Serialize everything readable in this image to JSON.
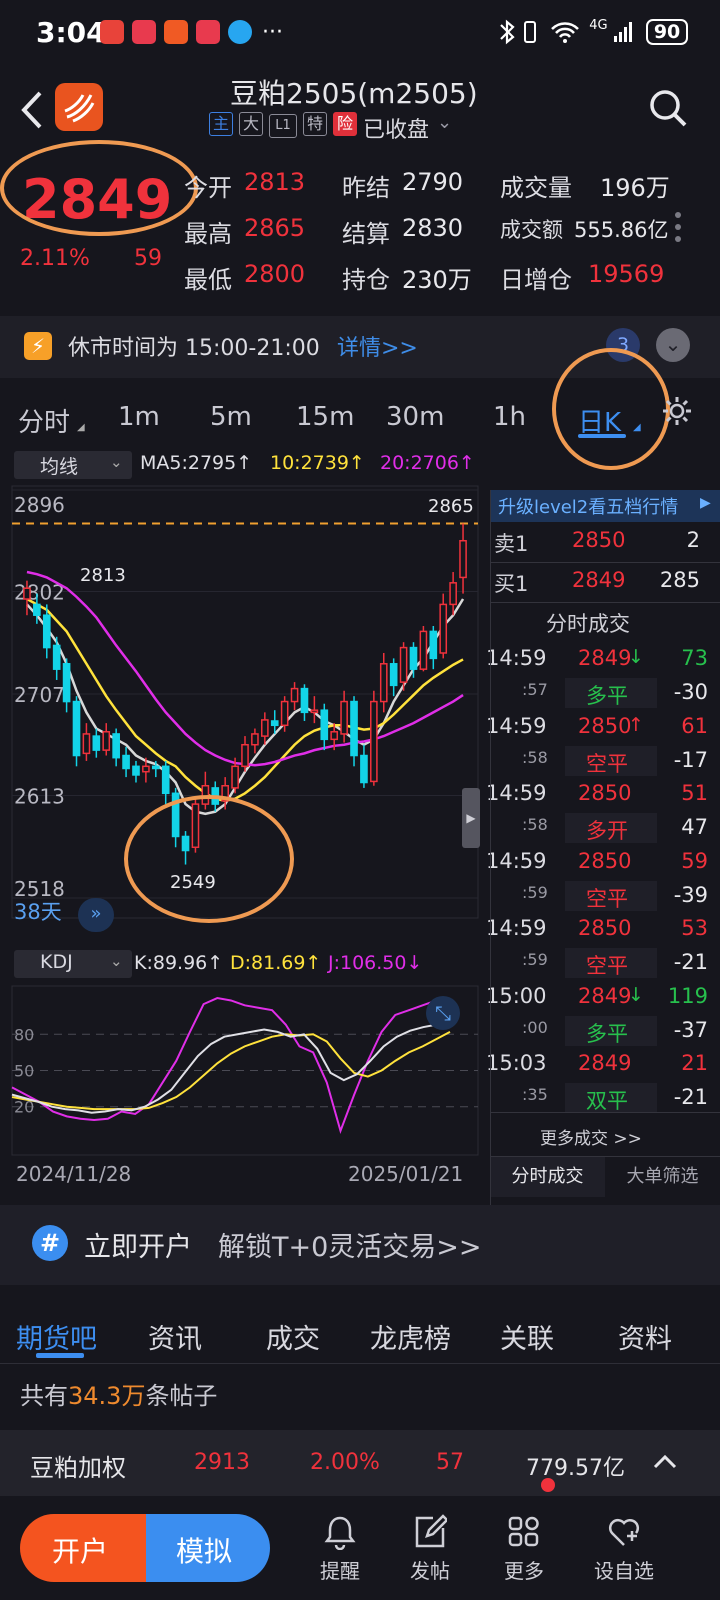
{
  "status_bar": {
    "time": "3:04",
    "network": "4G",
    "battery": "90",
    "more": "···"
  },
  "header": {
    "title": "豆粕2505(m2505)",
    "tags": [
      "主",
      "大",
      "L1",
      "特",
      "险"
    ],
    "status": "已收盘"
  },
  "quote": {
    "price": "2849",
    "change_pct": "2.11%",
    "change": "59",
    "fields": [
      {
        "label": "今开",
        "value": "2813",
        "color": "red"
      },
      {
        "label": "昨结",
        "value": "2790",
        "color": "white"
      },
      {
        "label": "成交量",
        "value": "196万",
        "color": "white"
      },
      {
        "label": "最高",
        "value": "2865",
        "color": "red"
      },
      {
        "label": "结算",
        "value": "2830",
        "color": "white"
      },
      {
        "label": "成交额",
        "value": "555.86亿",
        "color": "white"
      },
      {
        "label": "最低",
        "value": "2800",
        "color": "red"
      },
      {
        "label": "持仓",
        "value": "230万",
        "color": "white"
      },
      {
        "label": "日增仓",
        "value": "19569",
        "color": "red"
      }
    ]
  },
  "notice": {
    "text": "休市时间为 15:00-21:00",
    "link": "详情>>",
    "badge": "3"
  },
  "period_tabs": [
    "分时",
    "1m",
    "5m",
    "15m",
    "30m",
    "1h",
    "日K"
  ],
  "selected_period": "日K",
  "ma": {
    "selector": "均线",
    "ma5": "MA5:2795↑",
    "ma10": "10:2739↑",
    "ma20": "20:2706↑"
  },
  "chart_data": {
    "type": "candlestick",
    "y_ticks": [
      "2896",
      "2802",
      "2707",
      "2613",
      "2518"
    ],
    "ylim": [
      2518,
      2896
    ],
    "x_labels": [
      "2024/11/28",
      "2025/01/21"
    ],
    "high_label": "2865",
    "low_label": "2549",
    "open_label": "2813",
    "days": "38天",
    "candles": [
      [
        2795,
        2805,
        2780,
        2812
      ],
      [
        2790,
        2780,
        2772,
        2800
      ],
      [
        2780,
        2750,
        2740,
        2790
      ],
      [
        2752,
        2730,
        2720,
        2760
      ],
      [
        2735,
        2700,
        2690,
        2740
      ],
      [
        2700,
        2650,
        2640,
        2705
      ],
      [
        2652,
        2670,
        2645,
        2680
      ],
      [
        2668,
        2655,
        2648,
        2675
      ],
      [
        2655,
        2672,
        2650,
        2680
      ],
      [
        2670,
        2648,
        2640,
        2675
      ],
      [
        2650,
        2638,
        2630,
        2658
      ],
      [
        2640,
        2632,
        2625,
        2645
      ],
      [
        2635,
        2640,
        2625,
        2648
      ],
      [
        2640,
        2638,
        2630,
        2645
      ],
      [
        2640,
        2615,
        2605,
        2645
      ],
      [
        2615,
        2575,
        2565,
        2620
      ],
      [
        2575,
        2562,
        2549,
        2580
      ],
      [
        2565,
        2605,
        2560,
        2610
      ],
      [
        2605,
        2622,
        2600,
        2635
      ],
      [
        2620,
        2605,
        2598,
        2626
      ],
      [
        2608,
        2622,
        2600,
        2630
      ],
      [
        2620,
        2640,
        2615,
        2648
      ],
      [
        2640,
        2660,
        2635,
        2668
      ],
      [
        2660,
        2670,
        2652,
        2675
      ],
      [
        2668,
        2683,
        2660,
        2690
      ],
      [
        2682,
        2678,
        2670,
        2692
      ],
      [
        2678,
        2700,
        2672,
        2705
      ],
      [
        2700,
        2712,
        2692,
        2718
      ],
      [
        2712,
        2690,
        2682,
        2716
      ],
      [
        2690,
        2692,
        2680,
        2705
      ],
      [
        2692,
        2665,
        2655,
        2698
      ],
      [
        2665,
        2672,
        2655,
        2680
      ],
      [
        2670,
        2700,
        2662,
        2710
      ],
      [
        2700,
        2650,
        2640,
        2705
      ],
      [
        2650,
        2625,
        2620,
        2660
      ],
      [
        2626,
        2700,
        2622,
        2710
      ],
      [
        2700,
        2735,
        2690,
        2745
      ],
      [
        2735,
        2715,
        2705,
        2740
      ],
      [
        2718,
        2750,
        2710,
        2755
      ],
      [
        2750,
        2730,
        2722,
        2755
      ],
      [
        2730,
        2765,
        2728,
        2770
      ],
      [
        2765,
        2740,
        2730,
        2770
      ],
      [
        2745,
        2790,
        2740,
        2800
      ],
      [
        2790,
        2810,
        2780,
        2820
      ],
      [
        2815,
        2849,
        2800,
        2865
      ]
    ],
    "series": [
      {
        "name": "MA5",
        "color": "#d8d8d8",
        "values": [
          2790,
          2780,
          2768,
          2755,
          2735,
          2710,
          2690,
          2675,
          2670,
          2665,
          2660,
          2650,
          2645,
          2642,
          2635,
          2625,
          2605,
          2598,
          2596,
          2598,
          2605,
          2620,
          2635,
          2648,
          2660,
          2670,
          2680,
          2690,
          2695,
          2690,
          2682,
          2678,
          2672,
          2665,
          2660,
          2665,
          2680,
          2700,
          2715,
          2730,
          2740,
          2755,
          2770,
          2780,
          2795
        ]
      },
      {
        "name": "MA10",
        "color": "#ffe23c",
        "values": [
          2795,
          2790,
          2785,
          2775,
          2765,
          2750,
          2735,
          2720,
          2705,
          2692,
          2680,
          2668,
          2660,
          2652,
          2645,
          2640,
          2630,
          2622,
          2615,
          2610,
          2608,
          2610,
          2615,
          2622,
          2630,
          2640,
          2650,
          2660,
          2668,
          2673,
          2676,
          2678,
          2678,
          2676,
          2674,
          2675,
          2680,
          2688,
          2697,
          2706,
          2715,
          2722,
          2728,
          2734,
          2739
        ]
      },
      {
        "name": "MA20",
        "color": "#e02ee8",
        "values": [
          2820,
          2818,
          2815,
          2810,
          2805,
          2797,
          2788,
          2778,
          2765,
          2752,
          2740,
          2728,
          2715,
          2702,
          2690,
          2680,
          2670,
          2662,
          2655,
          2650,
          2646,
          2643,
          2642,
          2641,
          2642,
          2644,
          2647,
          2650,
          2652,
          2655,
          2657,
          2659,
          2660,
          2662,
          2663,
          2665,
          2668,
          2672,
          2676,
          2680,
          2685,
          2690,
          2695,
          2700,
          2706
        ]
      }
    ]
  },
  "kdj": {
    "selector": "KDJ",
    "k": "K:89.96↑",
    "d": "D:81.69↑",
    "j": "J:106.50↓",
    "levels": [
      "80",
      "50",
      "20"
    ]
  },
  "level2": "升级level2看五档行情",
  "orderbook": [
    {
      "label": "卖1",
      "price": "2850",
      "qty": "2"
    },
    {
      "label": "买1",
      "price": "2849",
      "qty": "285"
    }
  ],
  "trades_title": "分时成交",
  "trades": [
    {
      "time": "14:59",
      "price": "2849",
      "arrow": "↓",
      "vol": "73",
      "vcolor": "green",
      "sub": ":57",
      "kind": "多平",
      "delta": "-30",
      "kcolor": "green"
    },
    {
      "time": "14:59",
      "price": "2850",
      "arrow": "↑",
      "vol": "61",
      "vcolor": "red",
      "sub": ":58",
      "kind": "空平",
      "delta": "-17",
      "kcolor": "red"
    },
    {
      "time": "14:59",
      "price": "2850",
      "arrow": "",
      "vol": "51",
      "vcolor": "red",
      "sub": ":58",
      "kind": "多开",
      "delta": "47",
      "kcolor": "red"
    },
    {
      "time": "14:59",
      "price": "2850",
      "arrow": "",
      "vol": "59",
      "vcolor": "red",
      "sub": ":59",
      "kind": "空平",
      "delta": "-39",
      "kcolor": "red"
    },
    {
      "time": "14:59",
      "price": "2850",
      "arrow": "",
      "vol": "53",
      "vcolor": "red",
      "sub": ":59",
      "kind": "空平",
      "delta": "-21",
      "kcolor": "red"
    },
    {
      "time": "15:00",
      "price": "2849",
      "arrow": "↓",
      "vol": "119",
      "vcolor": "green",
      "sub": ":00",
      "kind": "多平",
      "delta": "-37",
      "kcolor": "green"
    },
    {
      "time": "15:03",
      "price": "2849",
      "arrow": "",
      "vol": "21",
      "vcolor": "red",
      "sub": ":35",
      "kind": "双平",
      "delta": "-21",
      "kcolor": "green"
    }
  ],
  "more_trades": "更多成交 >>",
  "panel_tabs": [
    "分时成交",
    "大单筛选"
  ],
  "open_account": {
    "text": "立即开户",
    "sub": "解锁T+0灵活交易>>"
  },
  "bottom_tabs": [
    "期货吧",
    "资讯",
    "成交",
    "龙虎榜",
    "关联",
    "资料"
  ],
  "posts": {
    "prefix": "共有",
    "count": "34.3万",
    "suffix": "条帖子"
  },
  "weighted": {
    "name": "豆粕加权",
    "price": "2913",
    "pct": "2.00%",
    "chg": "57",
    "amount": "779.57亿"
  },
  "nav": {
    "open": "开户",
    "sim": "模拟",
    "items": [
      "提醒",
      "发帖",
      "更多",
      "设自选"
    ]
  }
}
